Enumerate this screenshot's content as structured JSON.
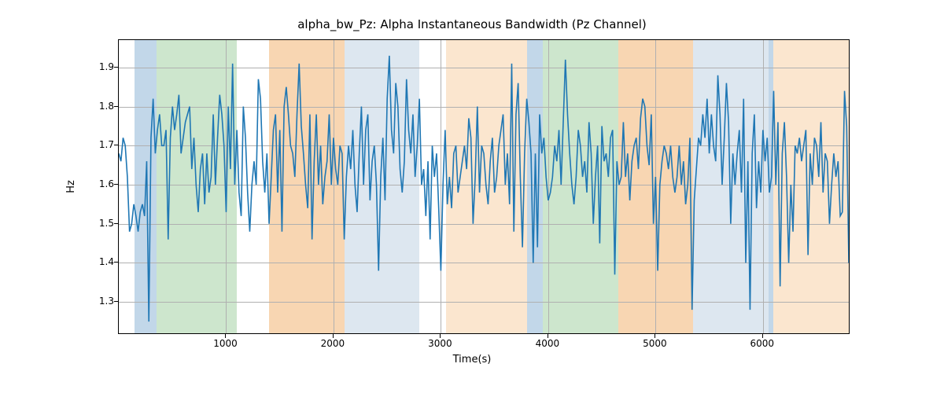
{
  "chart_data": {
    "type": "line",
    "title": "alpha_bw_Pz: Alpha Instantaneous Bandwidth (Pz Channel)",
    "xlabel": "Time(s)",
    "ylabel": "Hz",
    "xlim": [
      0,
      6800
    ],
    "ylim": [
      1.22,
      1.97
    ],
    "xticks": [
      1000,
      2000,
      3000,
      4000,
      5000,
      6000
    ],
    "yticks": [
      1.3,
      1.4,
      1.5,
      1.6,
      1.7,
      1.8,
      1.9
    ],
    "line_color": "#1f77b4",
    "bands": [
      {
        "x0": 150,
        "x1": 350,
        "color": "#c2d7e9"
      },
      {
        "x0": 350,
        "x1": 1100,
        "color": "#cde6cd"
      },
      {
        "x0": 1400,
        "x1": 2100,
        "color": "#f8d6b2"
      },
      {
        "x0": 2100,
        "x1": 2800,
        "color": "#dde7f0"
      },
      {
        "x0": 3050,
        "x1": 3800,
        "color": "#fbe6cf"
      },
      {
        "x0": 3800,
        "x1": 3950,
        "color": "#c2d7e9"
      },
      {
        "x0": 3950,
        "x1": 4650,
        "color": "#cde6cd"
      },
      {
        "x0": 4650,
        "x1": 5350,
        "color": "#f8d6b2"
      },
      {
        "x0": 5350,
        "x1": 6050,
        "color": "#dde7f0"
      },
      {
        "x0": 6050,
        "x1": 6100,
        "color": "#c2d7e9"
      },
      {
        "x0": 6100,
        "x1": 6800,
        "color": "#fbe6cf"
      }
    ],
    "x": [
      0,
      20,
      40,
      60,
      80,
      100,
      120,
      140,
      160,
      180,
      200,
      220,
      240,
      260,
      280,
      300,
      320,
      340,
      360,
      380,
      400,
      420,
      440,
      460,
      480,
      500,
      520,
      540,
      560,
      580,
      600,
      620,
      640,
      660,
      680,
      700,
      720,
      740,
      760,
      780,
      800,
      820,
      840,
      860,
      880,
      900,
      920,
      940,
      960,
      980,
      1000,
      1020,
      1040,
      1060,
      1080,
      1100,
      1120,
      1140,
      1160,
      1180,
      1200,
      1220,
      1240,
      1260,
      1280,
      1300,
      1320,
      1340,
      1360,
      1380,
      1400,
      1420,
      1440,
      1460,
      1480,
      1500,
      1520,
      1540,
      1560,
      1580,
      1600,
      1620,
      1640,
      1660,
      1680,
      1700,
      1720,
      1740,
      1760,
      1780,
      1800,
      1820,
      1840,
      1860,
      1880,
      1900,
      1920,
      1940,
      1960,
      1980,
      2000,
      2020,
      2040,
      2060,
      2080,
      2100,
      2120,
      2140,
      2160,
      2180,
      2200,
      2220,
      2240,
      2260,
      2280,
      2300,
      2320,
      2340,
      2360,
      2380,
      2400,
      2420,
      2440,
      2460,
      2480,
      2500,
      2520,
      2540,
      2560,
      2580,
      2600,
      2620,
      2640,
      2660,
      2680,
      2700,
      2720,
      2740,
      2760,
      2780,
      2800,
      2820,
      2840,
      2860,
      2880,
      2900,
      2920,
      2940,
      2960,
      2980,
      3000,
      3020,
      3040,
      3060,
      3080,
      3100,
      3120,
      3140,
      3160,
      3180,
      3200,
      3220,
      3240,
      3260,
      3280,
      3300,
      3320,
      3340,
      3360,
      3380,
      3400,
      3420,
      3440,
      3460,
      3480,
      3500,
      3520,
      3540,
      3560,
      3580,
      3600,
      3620,
      3640,
      3660,
      3680,
      3700,
      3720,
      3740,
      3760,
      3780,
      3800,
      3820,
      3840,
      3860,
      3880,
      3900,
      3920,
      3940,
      3960,
      3980,
      4000,
      4020,
      4040,
      4060,
      4080,
      4100,
      4120,
      4140,
      4160,
      4180,
      4200,
      4220,
      4240,
      4260,
      4280,
      4300,
      4320,
      4340,
      4360,
      4380,
      4400,
      4420,
      4440,
      4460,
      4480,
      4500,
      4520,
      4540,
      4560,
      4580,
      4600,
      4620,
      4640,
      4660,
      4680,
      4700,
      4720,
      4740,
      4760,
      4780,
      4800,
      4820,
      4840,
      4860,
      4880,
      4900,
      4920,
      4940,
      4960,
      4980,
      5000,
      5020,
      5040,
      5060,
      5080,
      5100,
      5120,
      5140,
      5160,
      5180,
      5200,
      5220,
      5240,
      5260,
      5280,
      5300,
      5320,
      5340,
      5360,
      5380,
      5400,
      5420,
      5440,
      5460,
      5480,
      5500,
      5520,
      5540,
      5560,
      5580,
      5600,
      5620,
      5640,
      5660,
      5680,
      5700,
      5720,
      5740,
      5760,
      5780,
      5800,
      5820,
      5840,
      5860,
      5880,
      5900,
      5920,
      5940,
      5960,
      5980,
      6000,
      6020,
      6040,
      6060,
      6080,
      6100,
      6120,
      6140,
      6160,
      6180,
      6200,
      6220,
      6240,
      6260,
      6280,
      6300,
      6320,
      6340,
      6360,
      6380,
      6400,
      6420,
      6440,
      6460,
      6480,
      6500,
      6520,
      6540,
      6560,
      6580,
      6600,
      6620,
      6640,
      6660,
      6680,
      6700,
      6720,
      6740,
      6760,
      6780,
      6800
    ],
    "y": [
      1.68,
      1.66,
      1.72,
      1.7,
      1.62,
      1.48,
      1.5,
      1.55,
      1.52,
      1.48,
      1.53,
      1.55,
      1.52,
      1.66,
      1.25,
      1.72,
      1.82,
      1.68,
      1.74,
      1.78,
      1.7,
      1.7,
      1.74,
      1.46,
      1.72,
      1.8,
      1.74,
      1.78,
      1.83,
      1.68,
      1.72,
      1.76,
      1.78,
      1.8,
      1.64,
      1.72,
      1.6,
      1.53,
      1.64,
      1.68,
      1.55,
      1.68,
      1.58,
      1.62,
      1.78,
      1.6,
      1.72,
      1.83,
      1.78,
      1.7,
      1.53,
      1.8,
      1.64,
      1.91,
      1.6,
      1.74,
      1.58,
      1.52,
      1.8,
      1.72,
      1.58,
      1.48,
      1.6,
      1.66,
      1.6,
      1.87,
      1.82,
      1.66,
      1.58,
      1.68,
      1.5,
      1.62,
      1.74,
      1.78,
      1.58,
      1.74,
      1.48,
      1.8,
      1.85,
      1.78,
      1.7,
      1.68,
      1.62,
      1.78,
      1.91,
      1.75,
      1.68,
      1.6,
      1.54,
      1.78,
      1.46,
      1.66,
      1.78,
      1.6,
      1.7,
      1.55,
      1.62,
      1.66,
      1.78,
      1.6,
      1.72,
      1.64,
      1.6,
      1.7,
      1.68,
      1.46,
      1.62,
      1.7,
      1.64,
      1.74,
      1.6,
      1.53,
      1.68,
      1.8,
      1.6,
      1.74,
      1.78,
      1.56,
      1.66,
      1.7,
      1.6,
      1.38,
      1.62,
      1.72,
      1.56,
      1.82,
      1.93,
      1.74,
      1.68,
      1.86,
      1.8,
      1.64,
      1.58,
      1.66,
      1.87,
      1.74,
      1.68,
      1.78,
      1.62,
      1.7,
      1.82,
      1.6,
      1.64,
      1.52,
      1.66,
      1.46,
      1.7,
      1.62,
      1.68,
      1.54,
      1.38,
      1.6,
      1.74,
      1.55,
      1.62,
      1.54,
      1.68,
      1.7,
      1.58,
      1.62,
      1.66,
      1.7,
      1.64,
      1.77,
      1.72,
      1.5,
      1.62,
      1.8,
      1.58,
      1.7,
      1.68,
      1.6,
      1.55,
      1.66,
      1.72,
      1.58,
      1.62,
      1.7,
      1.74,
      1.78,
      1.6,
      1.68,
      1.55,
      1.91,
      1.48,
      1.78,
      1.86,
      1.62,
      1.44,
      1.68,
      1.82,
      1.76,
      1.68,
      1.4,
      1.68,
      1.44,
      1.78,
      1.68,
      1.72,
      1.62,
      1.56,
      1.58,
      1.62,
      1.7,
      1.66,
      1.74,
      1.6,
      1.76,
      1.92,
      1.78,
      1.68,
      1.6,
      1.55,
      1.62,
      1.74,
      1.7,
      1.62,
      1.66,
      1.58,
      1.76,
      1.68,
      1.5,
      1.62,
      1.7,
      1.45,
      1.75,
      1.66,
      1.68,
      1.62,
      1.72,
      1.74,
      1.37,
      1.66,
      1.6,
      1.62,
      1.76,
      1.62,
      1.68,
      1.56,
      1.66,
      1.7,
      1.72,
      1.64,
      1.77,
      1.82,
      1.8,
      1.7,
      1.65,
      1.78,
      1.5,
      1.62,
      1.38,
      1.6,
      1.66,
      1.7,
      1.68,
      1.64,
      1.7,
      1.62,
      1.58,
      1.62,
      1.7,
      1.6,
      1.66,
      1.55,
      1.6,
      1.72,
      1.28,
      1.56,
      1.64,
      1.72,
      1.7,
      1.78,
      1.72,
      1.82,
      1.68,
      1.78,
      1.7,
      1.66,
      1.88,
      1.78,
      1.6,
      1.72,
      1.86,
      1.76,
      1.5,
      1.68,
      1.6,
      1.68,
      1.74,
      1.58,
      1.82,
      1.4,
      1.66,
      1.28,
      1.68,
      1.78,
      1.54,
      1.66,
      1.58,
      1.74,
      1.66,
      1.72,
      1.58,
      1.62,
      1.84,
      1.6,
      1.76,
      1.34,
      1.68,
      1.76,
      1.62,
      1.4,
      1.6,
      1.48,
      1.7,
      1.68,
      1.72,
      1.66,
      1.7,
      1.74,
      1.42,
      1.68,
      1.6,
      1.72,
      1.7,
      1.62,
      1.76,
      1.58,
      1.68,
      1.66,
      1.5,
      1.6,
      1.68,
      1.62,
      1.66,
      1.52,
      1.53,
      1.84,
      1.75,
      1.4
    ]
  }
}
